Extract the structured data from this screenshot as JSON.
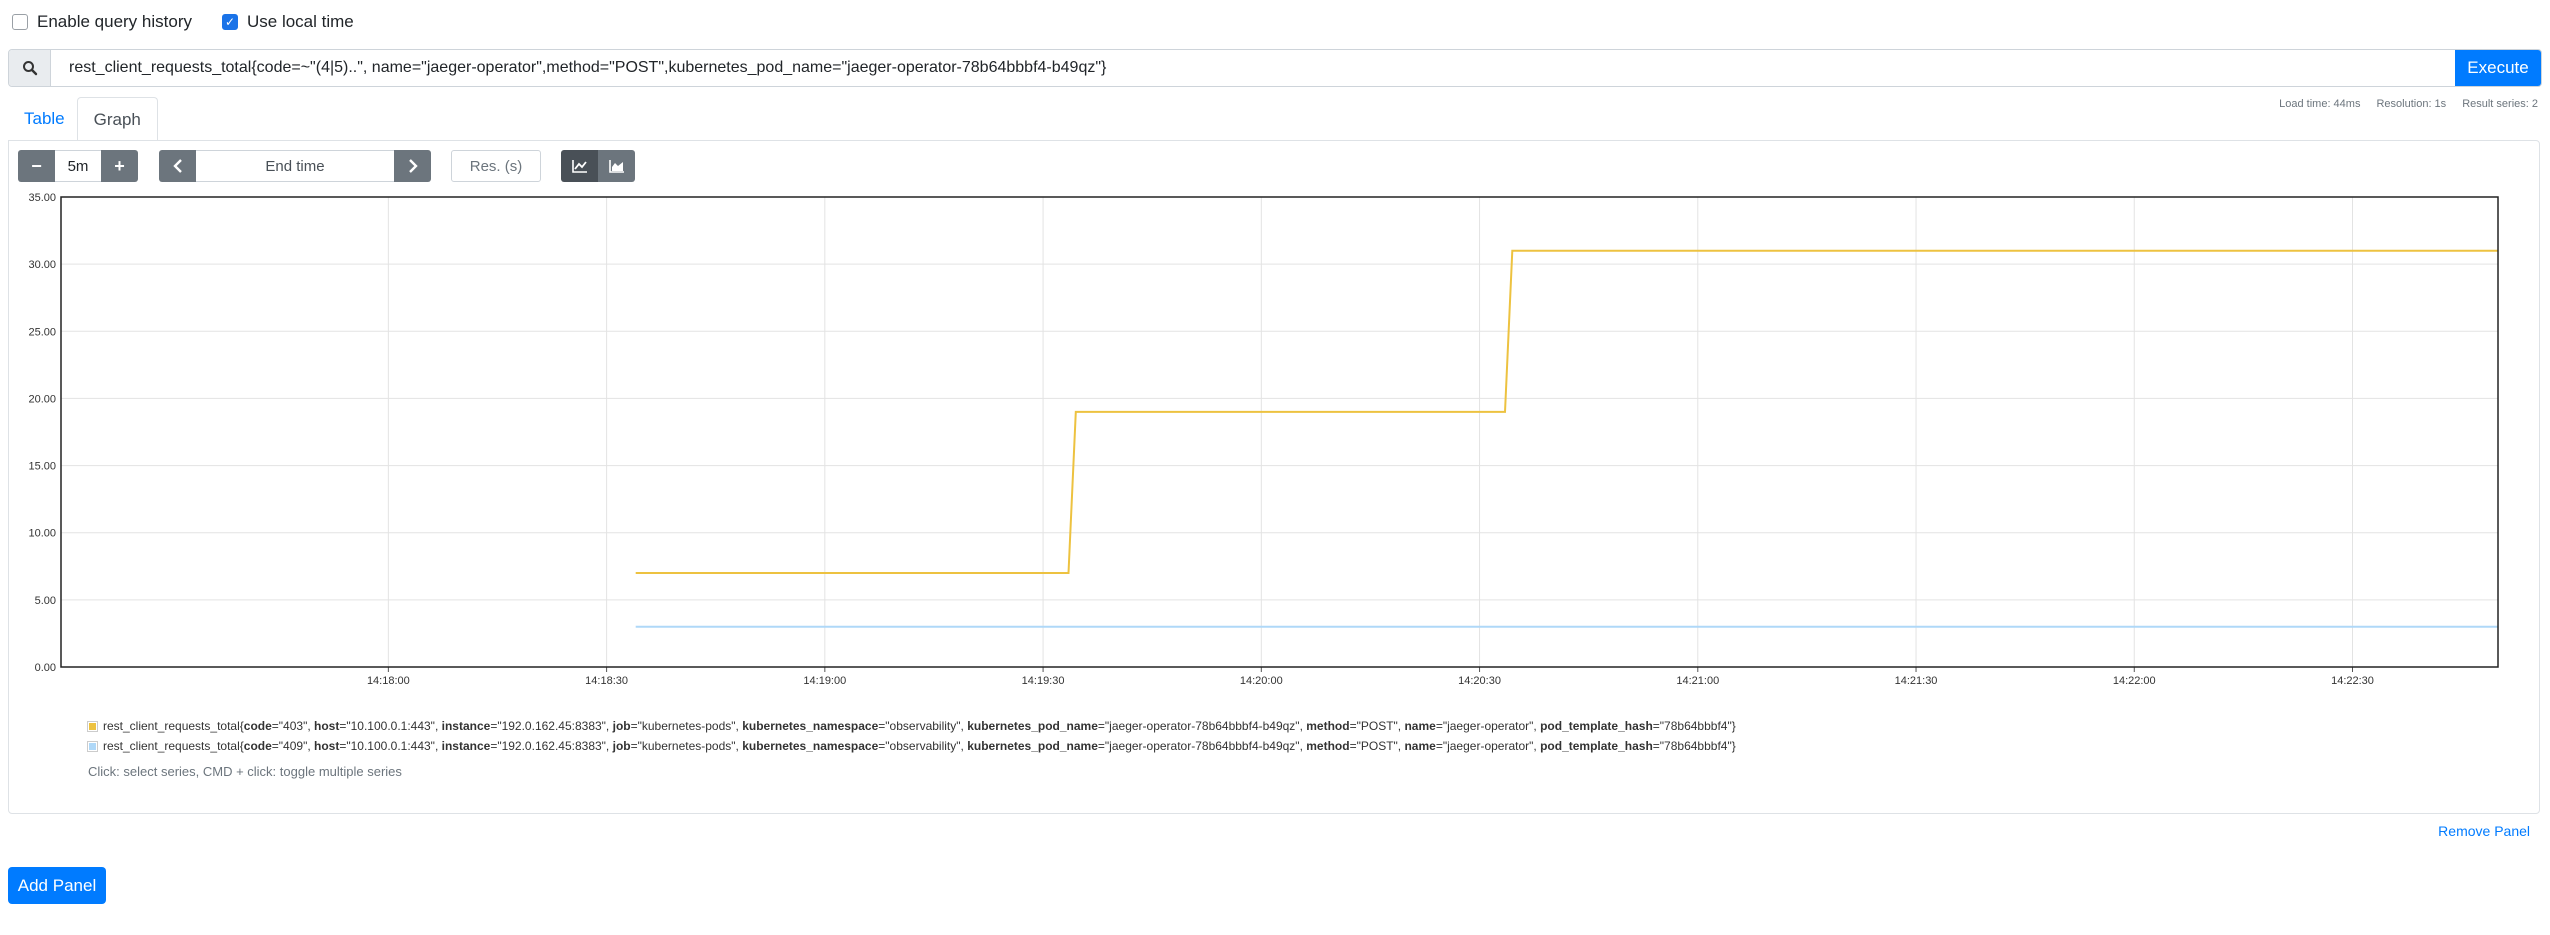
{
  "options": {
    "query_history": {
      "label": "Enable query history",
      "checked": false
    },
    "local_time": {
      "label": "Use local time",
      "checked": true
    }
  },
  "query": {
    "text": "rest_client_requests_total{code=~\"(4|5)..\", name=\"jaeger-operator\",method=\"POST\",kubernetes_pod_name=\"jaeger-operator-78b64bbbf4-b49qz\"}",
    "execute_label": "Execute"
  },
  "tabs": [
    {
      "label": "Table",
      "active": false
    },
    {
      "label": "Graph",
      "active": true
    }
  ],
  "stats": {
    "load_time": "Load time: 44ms",
    "resolution": "Resolution: 1s",
    "result_series": "Result series: 2"
  },
  "controls": {
    "minus": "−",
    "range": "5m",
    "plus": "+",
    "end_time_placeholder": "End time",
    "res_placeholder": "Res. (s)"
  },
  "chart_data": {
    "type": "line",
    "ylim": [
      0,
      35
    ],
    "yticks": [
      "0.00",
      "5.00",
      "10.00",
      "15.00",
      "20.00",
      "25.00",
      "30.00",
      "35.00"
    ],
    "xticks": [
      "14:18:00",
      "14:18:30",
      "14:19:00",
      "14:19:30",
      "14:20:00",
      "14:20:30",
      "14:21:00",
      "14:21:30",
      "14:22:00",
      "14:22:30"
    ],
    "xlim_seconds": [
      -45,
      290
    ],
    "grid": true,
    "series": [
      {
        "code": "403",
        "color": "#edc240",
        "x": [
          34,
          93.5,
          94.5,
          153.5,
          154.5,
          290
        ],
        "y": [
          7,
          7,
          19,
          19,
          31,
          31
        ]
      },
      {
        "code": "409",
        "color": "#afd8f8",
        "x": [
          34,
          290
        ],
        "y": [
          3,
          3
        ]
      }
    ]
  },
  "legend": {
    "series": [
      {
        "metric": "rest_client_requests_total",
        "color": "#edc240",
        "labels": [
          [
            "code",
            "403"
          ],
          [
            "host",
            "10.100.0.1:443"
          ],
          [
            "instance",
            "192.0.162.45:8383"
          ],
          [
            "job",
            "kubernetes-pods"
          ],
          [
            "kubernetes_namespace",
            "observability"
          ],
          [
            "kubernetes_pod_name",
            "jaeger-operator-78b64bbbf4-b49qz"
          ],
          [
            "method",
            "POST"
          ],
          [
            "name",
            "jaeger-operator"
          ],
          [
            "pod_template_hash",
            "78b64bbbf4"
          ]
        ]
      },
      {
        "metric": "rest_client_requests_total",
        "color": "#afd8f8",
        "labels": [
          [
            "code",
            "409"
          ],
          [
            "host",
            "10.100.0.1:443"
          ],
          [
            "instance",
            "192.0.162.45:8383"
          ],
          [
            "job",
            "kubernetes-pods"
          ],
          [
            "kubernetes_namespace",
            "observability"
          ],
          [
            "kubernetes_pod_name",
            "jaeger-operator-78b64bbbf4-b49qz"
          ],
          [
            "method",
            "POST"
          ],
          [
            "name",
            "jaeger-operator"
          ],
          [
            "pod_template_hash",
            "78b64bbbf4"
          ]
        ]
      }
    ],
    "hint": "Click: select series, CMD + click: toggle multiple series"
  },
  "remove_panel": "Remove Panel",
  "add_panel": "Add Panel"
}
